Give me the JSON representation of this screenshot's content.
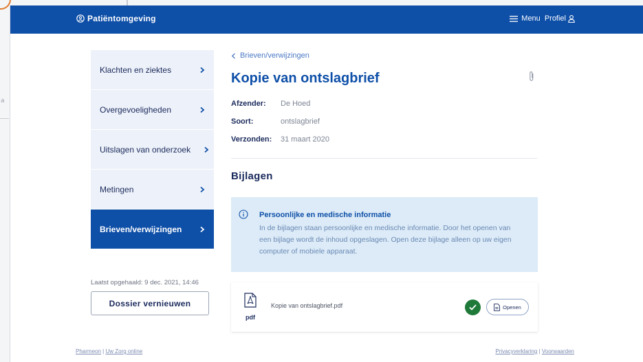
{
  "header": {
    "brand": "Patiëntomgeving",
    "menu_label": "Menu",
    "profile_label": "Profiel"
  },
  "sidebar": {
    "items": [
      {
        "label": "Klachten en ziektes"
      },
      {
        "label": "Overgevoeligheden"
      },
      {
        "label": "Uitslagen van onderzoek"
      },
      {
        "label": "Metingen"
      },
      {
        "label": "Brieven/verwijzingen",
        "active": true
      }
    ],
    "last_fetched": "Laatst opgehaald: 9 dec. 2021, 14:46",
    "renew_button": "Dossier vernieuwen"
  },
  "main": {
    "breadcrumb": "Brieven/verwijzingen",
    "title": "Kopie van ontslagbrief",
    "meta": {
      "sender_label": "Afzender:",
      "sender": "De Hoed",
      "type_label": "Soort:",
      "type": "ontslagbrief",
      "sent_label": "Verzonden:",
      "sent": "31 maart 2020"
    },
    "attachments_heading": "Bijlagen",
    "info": {
      "title": "Persoonlijke en medische informatie",
      "body": "In de bijlagen staan persoonlijke en medische informatie. Door het openen van een bijlage wordt de inhoud opgeslagen. Open deze bijlage alleen op uw eigen computer of mobiele apparaat."
    },
    "attachment": {
      "icon_label": "pdf",
      "filename": "Kopie van ontslagbrief.pdf",
      "open_label": "Openen"
    }
  },
  "footer": {
    "left_link_1": "Pharmeon",
    "left_sep": " | ",
    "left_link_2": "Uw Zorg online",
    "right_link_1": "Privacyverklaring",
    "right_sep": " | ",
    "right_link_2": "Voorwaarden"
  },
  "colors": {
    "primary": "#0e4fa8",
    "sidebar_bg": "#edf1f9",
    "info_bg": "#dcebf7",
    "success": "#1f7a3a"
  }
}
